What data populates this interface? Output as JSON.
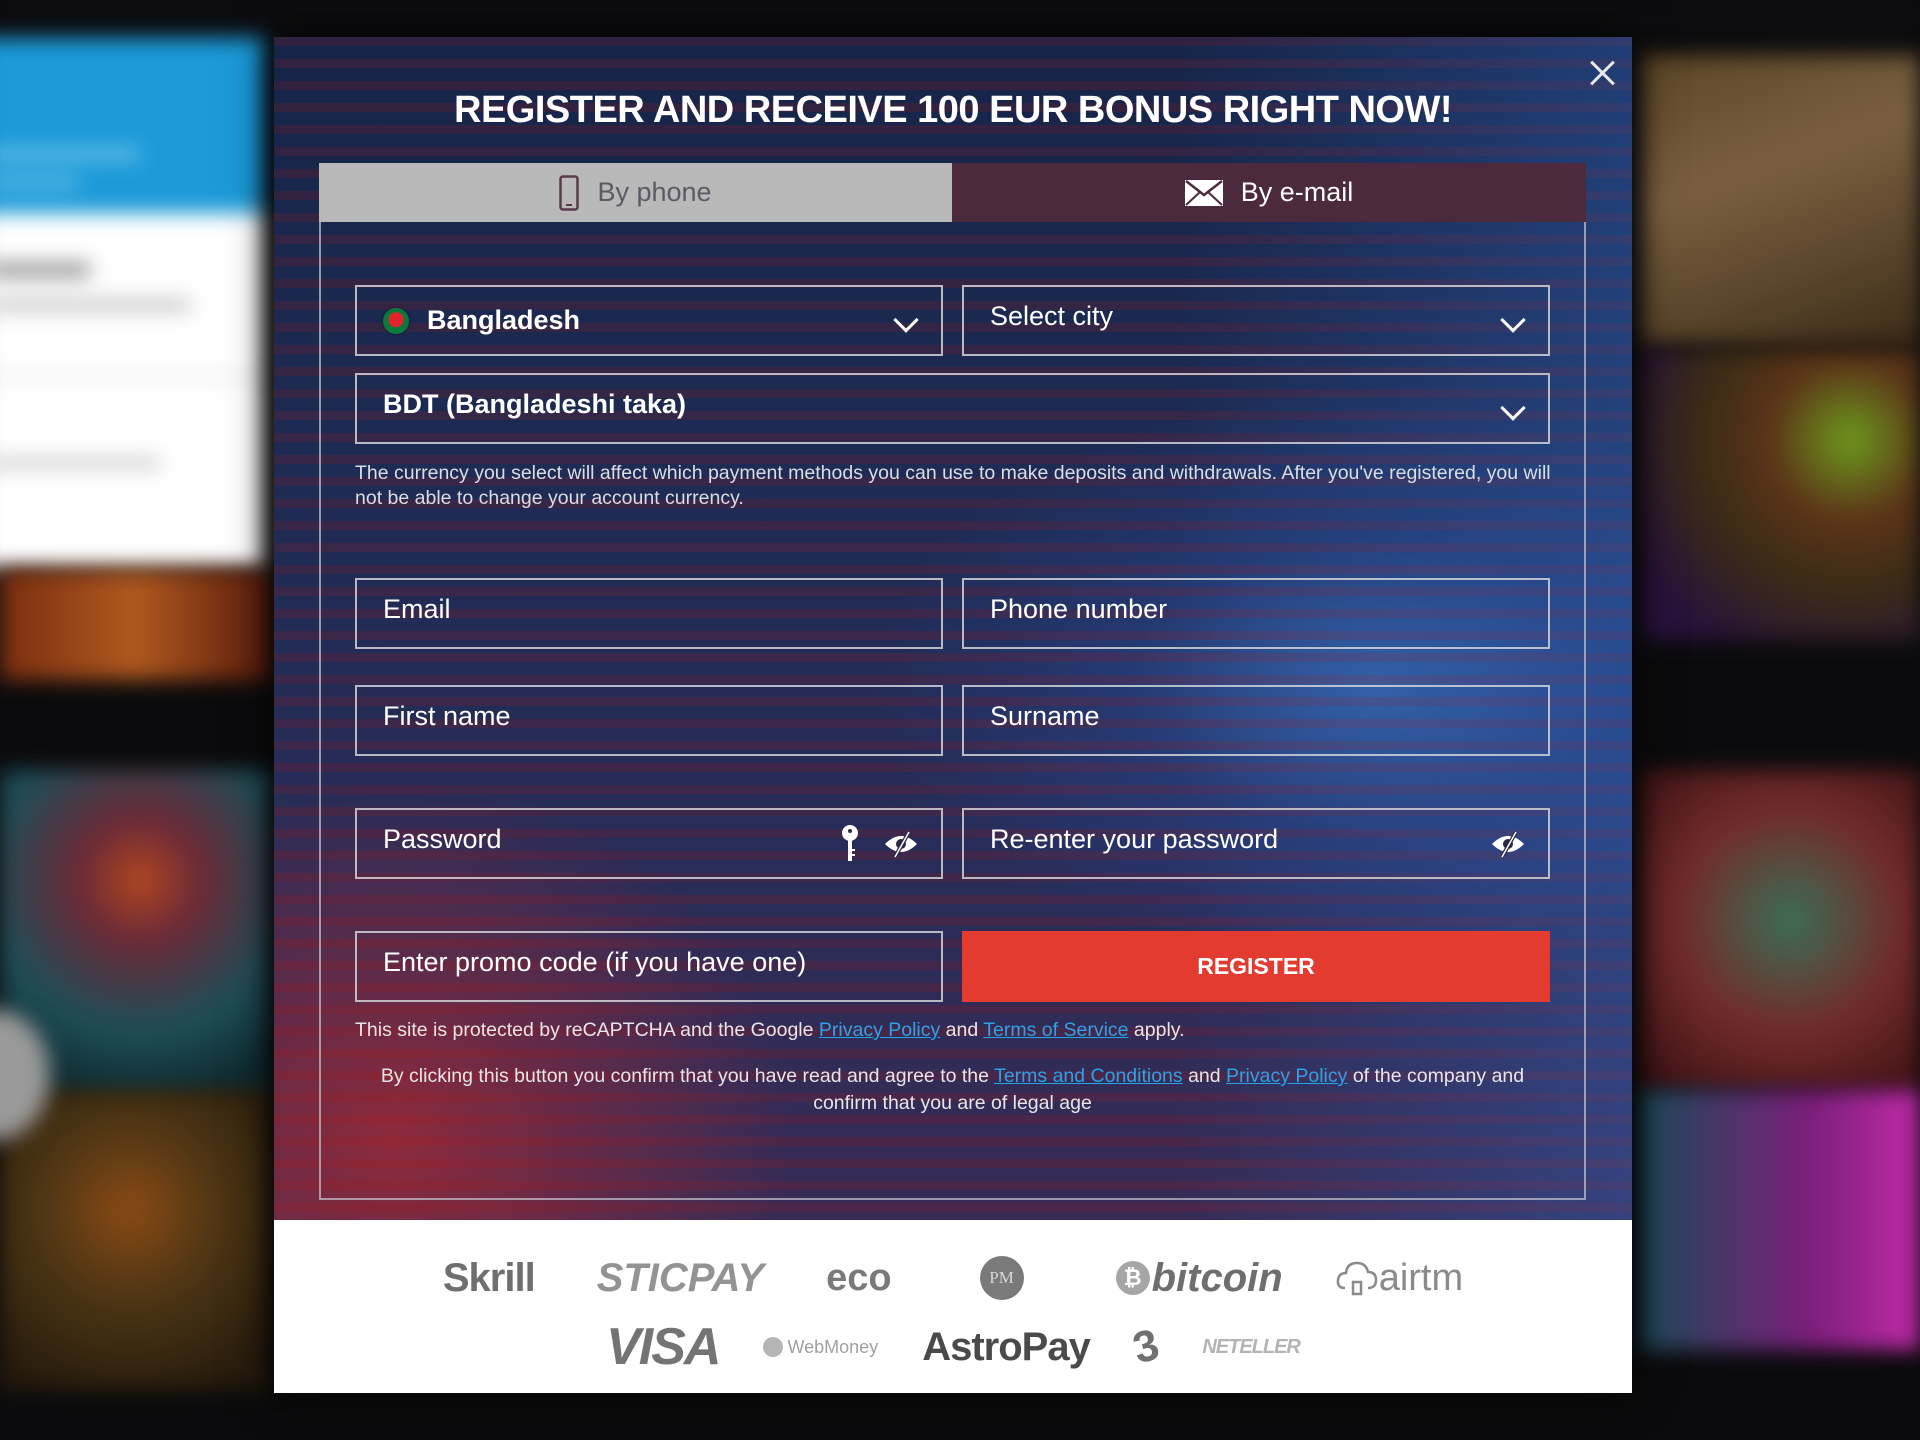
{
  "modal": {
    "title": "REGISTER AND RECEIVE 100 EUR BONUS RIGHT NOW!",
    "close_icon": "close-icon",
    "tabs": [
      {
        "label": "By phone",
        "icon": "phone-icon",
        "active": false
      },
      {
        "label": "By e-mail",
        "icon": "envelope-icon",
        "active": true
      }
    ],
    "form": {
      "country": {
        "value": "Bangladesh",
        "flag": "bangladesh-flag-icon"
      },
      "city": {
        "placeholder": "Select city"
      },
      "currency": {
        "value": "BDT (Bangladeshi taka)"
      },
      "currency_help": "The currency you select will affect which payment methods you can use to make deposits and withdrawals. After you've registered, you will not be able to change your account currency.",
      "email": {
        "placeholder": "Email"
      },
      "phone": {
        "placeholder": "Phone number"
      },
      "first_name": {
        "placeholder": "First name"
      },
      "surname": {
        "placeholder": "Surname"
      },
      "password": {
        "placeholder": "Password",
        "icons": [
          "key-icon",
          "eye-slash-icon"
        ]
      },
      "password_repeat": {
        "placeholder": "Re-enter your password",
        "icons": [
          "eye-slash-icon"
        ]
      },
      "promo": {
        "placeholder": "Enter promo code (if you have one)"
      },
      "register_label": "REGISTER"
    },
    "legal": {
      "recaptcha_prefix": "This site is protected by reCAPTCHA and the Google ",
      "recaptcha_privacy": "Privacy Policy",
      "recaptcha_and": " and ",
      "recaptcha_terms": "Terms of Service",
      "recaptcha_suffix": " apply.",
      "agree_prefix": "By clicking this button you confirm that you have read and agree to the ",
      "agree_terms": "Terms and Conditions",
      "agree_and": " and ",
      "agree_privacy": "Privacy Policy",
      "agree_suffix": " of the company and confirm that you are of legal age"
    },
    "payment_logos": {
      "row1": [
        "Skrill",
        "STICPAY",
        "eco",
        "PM",
        "bitcoin",
        "airtm"
      ],
      "row2": [
        "VISA",
        "WebMoney",
        "AstroPay",
        "3",
        "NETELLER"
      ]
    }
  },
  "colors": {
    "register_button": "#e43b30",
    "active_tab": "#4b2a3e",
    "inactive_tab": "#b9b9b9",
    "link": "#2aa3e8"
  }
}
